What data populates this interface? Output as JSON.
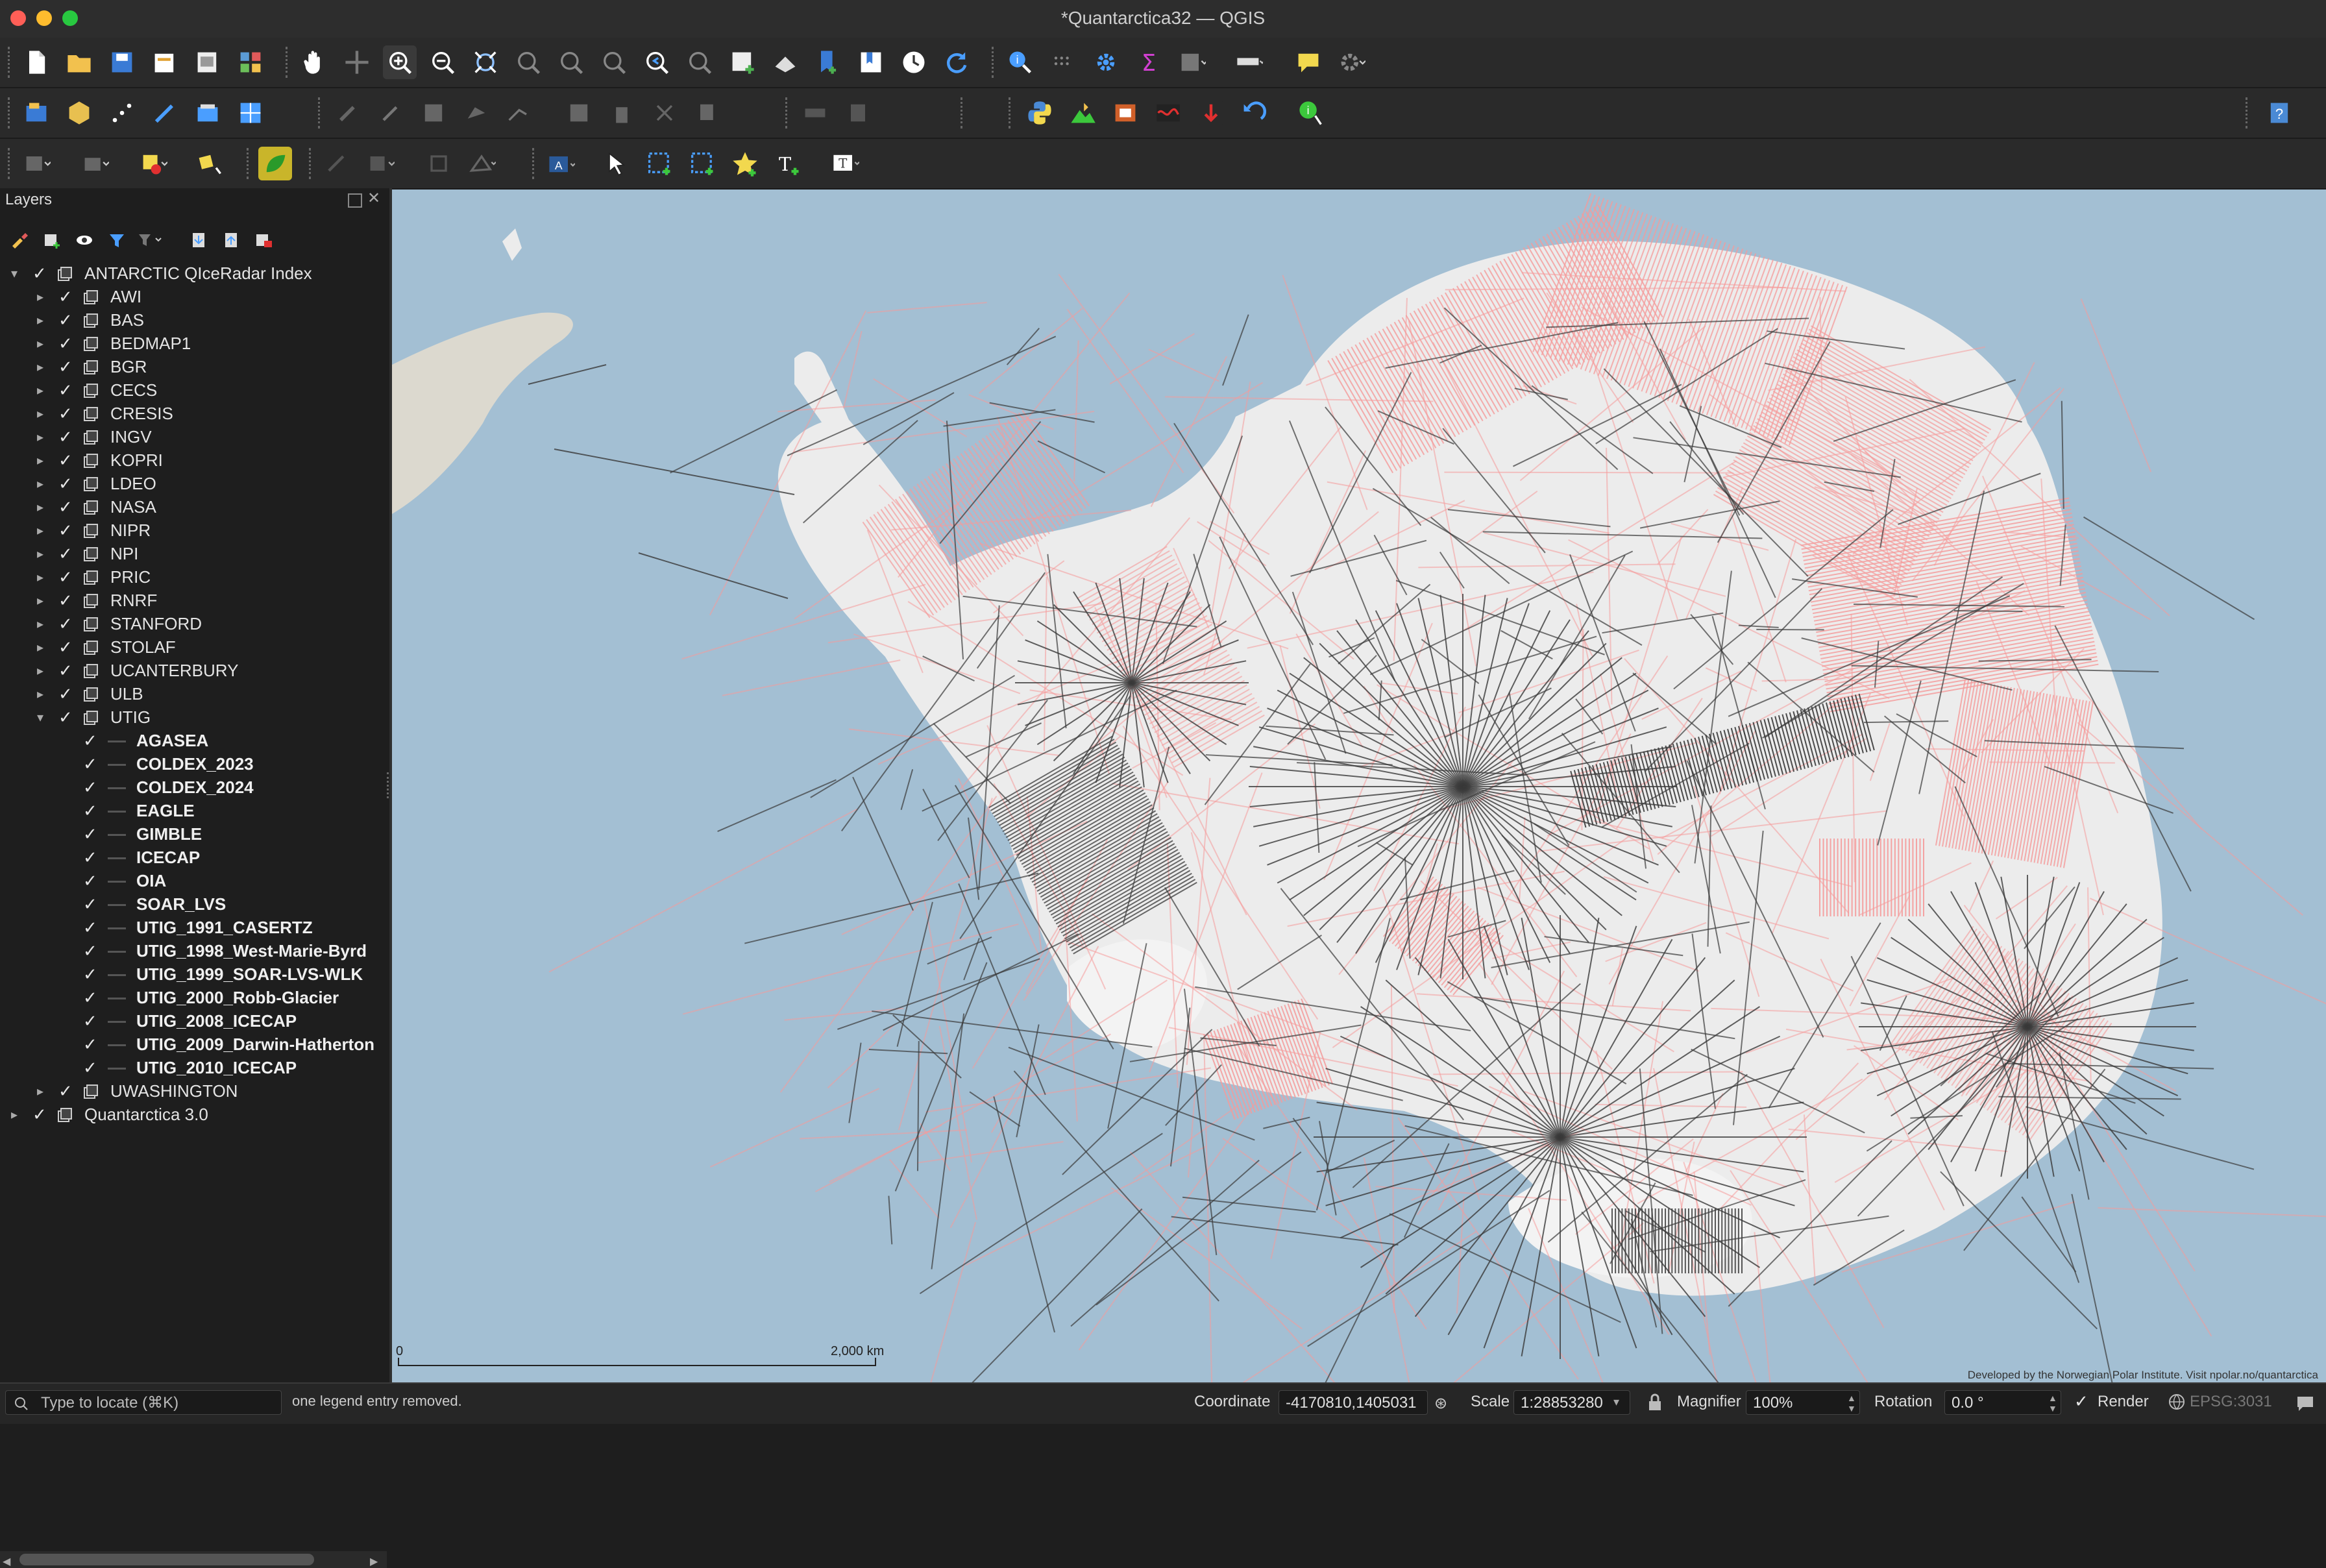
{
  "window": {
    "title": "*Quantarctica32 — QGIS"
  },
  "layers_panel": {
    "title": "Layers",
    "tree": [
      {
        "label": "ANTARCTIC QIceRadar Index",
        "level": 0,
        "expanded": true,
        "kind": "group"
      },
      {
        "label": "AWI",
        "level": 1,
        "expanded": false,
        "kind": "group"
      },
      {
        "label": "BAS",
        "level": 1,
        "expanded": false,
        "kind": "group"
      },
      {
        "label": "BEDMAP1",
        "level": 1,
        "expanded": false,
        "kind": "group"
      },
      {
        "label": "BGR",
        "level": 1,
        "expanded": false,
        "kind": "group"
      },
      {
        "label": "CECS",
        "level": 1,
        "expanded": false,
        "kind": "group"
      },
      {
        "label": "CRESIS",
        "level": 1,
        "expanded": false,
        "kind": "group"
      },
      {
        "label": "INGV",
        "level": 1,
        "expanded": false,
        "kind": "group"
      },
      {
        "label": "KOPRI",
        "level": 1,
        "expanded": false,
        "kind": "group"
      },
      {
        "label": "LDEO",
        "level": 1,
        "expanded": false,
        "kind": "group"
      },
      {
        "label": "NASA",
        "level": 1,
        "expanded": false,
        "kind": "group"
      },
      {
        "label": "NIPR",
        "level": 1,
        "expanded": false,
        "kind": "group"
      },
      {
        "label": "NPI",
        "level": 1,
        "expanded": false,
        "kind": "group"
      },
      {
        "label": "PRIC",
        "level": 1,
        "expanded": false,
        "kind": "group"
      },
      {
        "label": "RNRF",
        "level": 1,
        "expanded": false,
        "kind": "group"
      },
      {
        "label": "STANFORD",
        "level": 1,
        "expanded": false,
        "kind": "group"
      },
      {
        "label": "STOLAF",
        "level": 1,
        "expanded": false,
        "kind": "group"
      },
      {
        "label": "UCANTERBURY",
        "level": 1,
        "expanded": false,
        "kind": "group"
      },
      {
        "label": "ULB",
        "level": 1,
        "expanded": false,
        "kind": "group"
      },
      {
        "label": "UTIG",
        "level": 1,
        "expanded": true,
        "kind": "group"
      },
      {
        "label": "AGASEA",
        "level": 2,
        "kind": "layer"
      },
      {
        "label": "COLDEX_2023",
        "level": 2,
        "kind": "layer"
      },
      {
        "label": "COLDEX_2024",
        "level": 2,
        "kind": "layer"
      },
      {
        "label": "EAGLE",
        "level": 2,
        "kind": "layer"
      },
      {
        "label": "GIMBLE",
        "level": 2,
        "kind": "layer"
      },
      {
        "label": "ICECAP",
        "level": 2,
        "kind": "layer"
      },
      {
        "label": "OIA",
        "level": 2,
        "kind": "layer"
      },
      {
        "label": "SOAR_LVS",
        "level": 2,
        "kind": "layer"
      },
      {
        "label": "UTIG_1991_CASERTZ",
        "level": 2,
        "kind": "layer"
      },
      {
        "label": "UTIG_1998_West-Marie-Byrd",
        "level": 2,
        "kind": "layer"
      },
      {
        "label": "UTIG_1999_SOAR-LVS-WLK",
        "level": 2,
        "kind": "layer"
      },
      {
        "label": "UTIG_2000_Robb-Glacier",
        "level": 2,
        "kind": "layer"
      },
      {
        "label": "UTIG_2008_ICECAP",
        "level": 2,
        "kind": "layer"
      },
      {
        "label": "UTIG_2009_Darwin-Hatherton",
        "level": 2,
        "kind": "layer"
      },
      {
        "label": "UTIG_2010_ICECAP",
        "level": 2,
        "kind": "layer"
      },
      {
        "label": "UWASHINGTON",
        "level": 1,
        "expanded": false,
        "kind": "group"
      },
      {
        "label": "Quantarctica 3.0",
        "level": 0,
        "expanded": false,
        "kind": "group"
      }
    ]
  },
  "map": {
    "scalebar_start": "0",
    "scalebar_end": "2,000 km",
    "credit": "Developed by the Norwegian Polar Institute. Visit npolar.no/quantarctica",
    "colors": {
      "ocean": "#a3bfd3",
      "ice": "#ececec",
      "land": "#dcd9cf",
      "track_pink": "#f59a9a",
      "track_dark": "#3a3a3a"
    }
  },
  "statusbar": {
    "locator_placeholder": "Type to locate (⌘K)",
    "message": "one legend entry removed.",
    "coordinate_label": "Coordinate",
    "coordinate_value": "-4170810,1405031",
    "scale_label": "Scale",
    "scale_value": "1:28853280",
    "magnifier_label": "Magnifier",
    "magnifier_value": "100%",
    "rotation_label": "Rotation",
    "rotation_value": "0.0 °",
    "render_label": "Render",
    "crs": "EPSG:3031"
  }
}
